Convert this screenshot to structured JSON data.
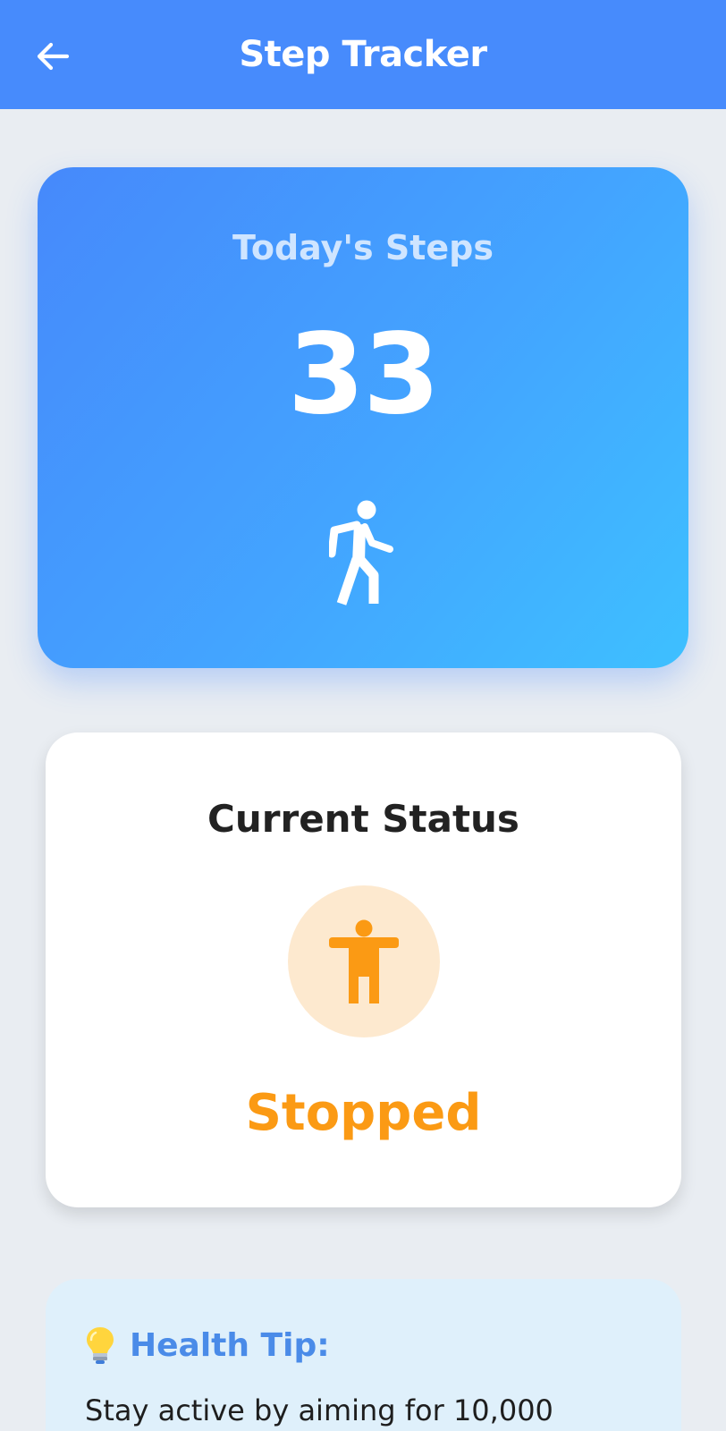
{
  "appbar": {
    "title": "Step Tracker",
    "back_icon": "arrow-left-icon"
  },
  "steps_card": {
    "label": "Today's Steps",
    "count": "33",
    "icon": "walking-person-icon"
  },
  "status_card": {
    "title": "Current Status",
    "value": "Stopped",
    "icon": "standing-person-icon"
  },
  "tip_card": {
    "icon": "lightbulb-icon",
    "title": "Health Tip:",
    "text": "Stay active by aiming for 10,000"
  },
  "colors": {
    "appbar": "#478bfc",
    "steps_gradient_start": "#4689fb",
    "steps_gradient_end": "#3ec0ff",
    "status_accent": "#fb9a14",
    "status_circle_bg": "#fde9cf",
    "tip_title": "#4a8be8",
    "tip_bg": "#dff0fb"
  }
}
